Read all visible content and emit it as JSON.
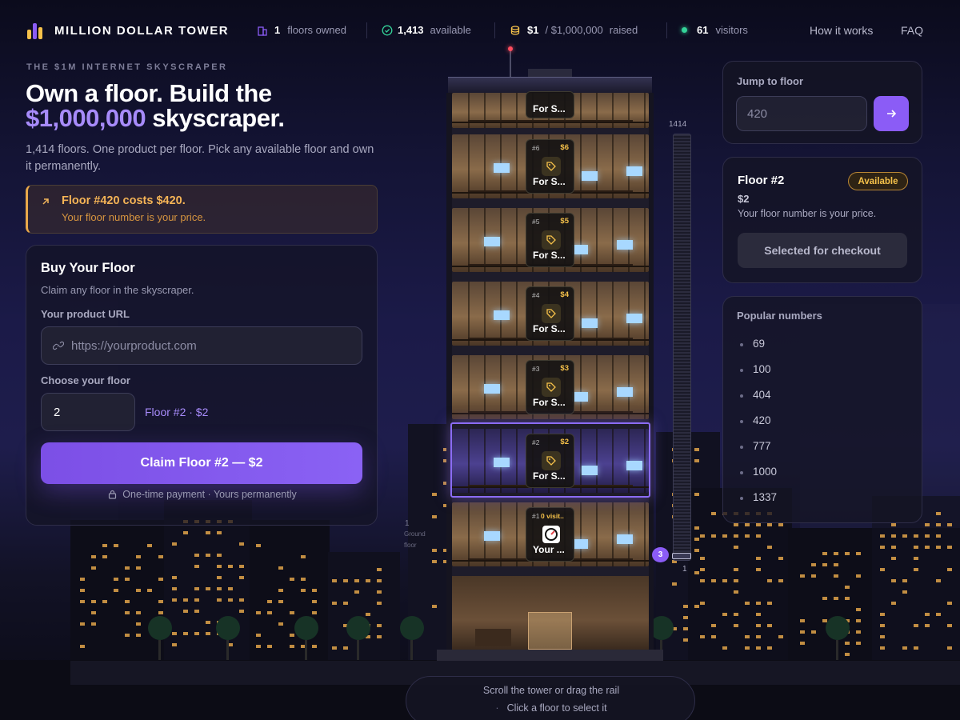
{
  "brand": "MILLION DOLLAR TOWER",
  "stats": {
    "owned_value": "1",
    "owned_label": "floors owned",
    "available_value": "1,413",
    "available_label": "available",
    "raised_value": "$1",
    "raised_total": "/ $1,000,000",
    "raised_label": "raised",
    "visitors_value": "61",
    "visitors_label": "visitors"
  },
  "nav": {
    "how": "How it works",
    "faq": "FAQ"
  },
  "hero": {
    "eyebrow": "THE $1M INTERNET SKYSCRAPER",
    "title_line1": "Own a floor. Build the",
    "title_accent": "$1,000,000",
    "title_rest": "skyscraper.",
    "subtitle": "1,414 floors. One product per floor. Pick any available floor and own it permanently."
  },
  "promo": {
    "title": "Floor #420 costs $420.",
    "text": "Your floor number is your price."
  },
  "buy": {
    "title": "Buy Your Floor",
    "subtitle": "Claim any floor in the skyscraper.",
    "url_label": "Your product URL",
    "url_placeholder": "https://yourproduct.com",
    "floor_label": "Choose your floor",
    "floor_value": "2",
    "floor_hint": "Floor #2 · $2",
    "claim_button": "Claim Floor #2 — $2",
    "footnote": "One-time payment · Yours permanently"
  },
  "tower": {
    "floors": [
      {
        "num": "",
        "price": "",
        "label": "For S..."
      },
      {
        "num": "#6",
        "price": "$6",
        "label": "For S..."
      },
      {
        "num": "#5",
        "price": "$5",
        "label": "For S..."
      },
      {
        "num": "#4",
        "price": "$4",
        "label": "For S..."
      },
      {
        "num": "#3",
        "price": "$3",
        "label": "For S..."
      },
      {
        "num": "#2",
        "price": "$2",
        "label": "For S..."
      },
      {
        "num": "#1",
        "price": "0 visit..",
        "label": "Your ..."
      }
    ],
    "ground_num": "1",
    "ground_label1": "Ground",
    "ground_label2": "floor",
    "rail_top": "1414",
    "rail_bottom": "1",
    "rail_badge": "3"
  },
  "jump": {
    "label": "Jump to floor",
    "placeholder": "420"
  },
  "selected": {
    "title": "Floor #2",
    "badge": "Available",
    "price": "$2",
    "text": "Your floor number is your price.",
    "button": "Selected for checkout"
  },
  "popular": {
    "title": "Popular numbers",
    "items": [
      "69",
      "100",
      "404",
      "420",
      "777",
      "1000",
      "1337"
    ]
  },
  "hint": {
    "line1": "Scroll the tower or drag the rail",
    "line2": "Click a floor to select it"
  },
  "colors": {
    "accent": "#8b5cf6",
    "gold": "#f5c14a",
    "bg": "#141435"
  }
}
